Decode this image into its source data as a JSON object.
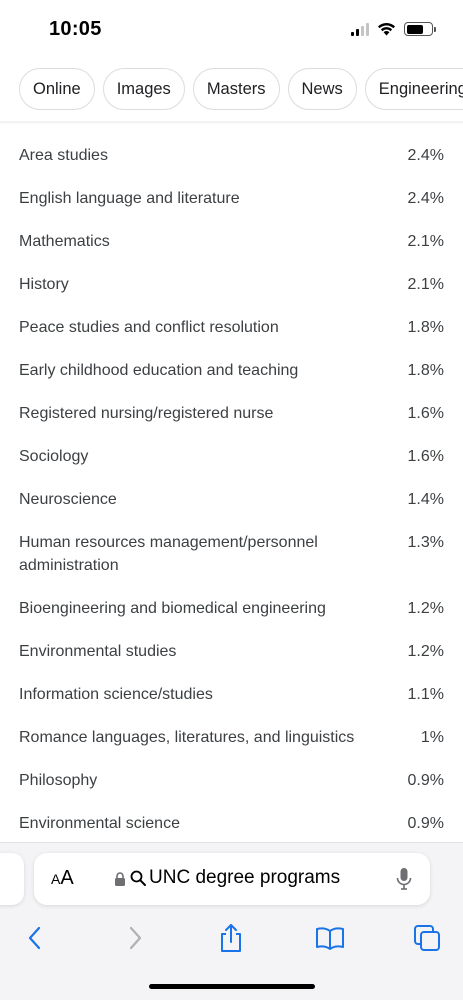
{
  "status_bar": {
    "time": "10:05"
  },
  "chips": [
    "Online",
    "Images",
    "Masters",
    "News",
    "Engineering"
  ],
  "rows": [
    {
      "label": "Area studies",
      "value": "2.4%"
    },
    {
      "label": "English language and literature",
      "value": "2.4%"
    },
    {
      "label": "Mathematics",
      "value": "2.1%"
    },
    {
      "label": "History",
      "value": "2.1%"
    },
    {
      "label": "Peace studies and conflict resolution",
      "value": "1.8%"
    },
    {
      "label": "Early childhood education and teaching",
      "value": "1.8%"
    },
    {
      "label": "Registered nursing/registered nurse",
      "value": "1.6%"
    },
    {
      "label": "Sociology",
      "value": "1.6%"
    },
    {
      "label": "Neuroscience",
      "value": "1.4%"
    },
    {
      "label": "Human resources management/personnel administration",
      "value": "1.3%"
    },
    {
      "label": "Bioengineering and biomedical engineering",
      "value": "1.2%"
    },
    {
      "label": "Environmental studies",
      "value": "1.2%"
    },
    {
      "label": "Information science/studies",
      "value": "1.1%"
    },
    {
      "label": "Romance languages, literatures, and linguistics",
      "value": "1%"
    },
    {
      "label": "Philosophy",
      "value": "0.9%"
    },
    {
      "label": "Environmental science",
      "value": "0.9%"
    }
  ],
  "address_bar": {
    "format_label_small": "A",
    "format_label_large": "A",
    "query": "UNC degree programs"
  },
  "icons": {
    "back": "chevron-left-icon",
    "forward": "chevron-right-icon",
    "share": "share-icon",
    "bookmarks": "book-icon",
    "tabs": "tabs-icon",
    "lock": "lock-icon",
    "search": "search-icon",
    "mic": "microphone-icon"
  },
  "colors": {
    "accent": "#1a73e8",
    "disabled": "#b0b0b5"
  }
}
